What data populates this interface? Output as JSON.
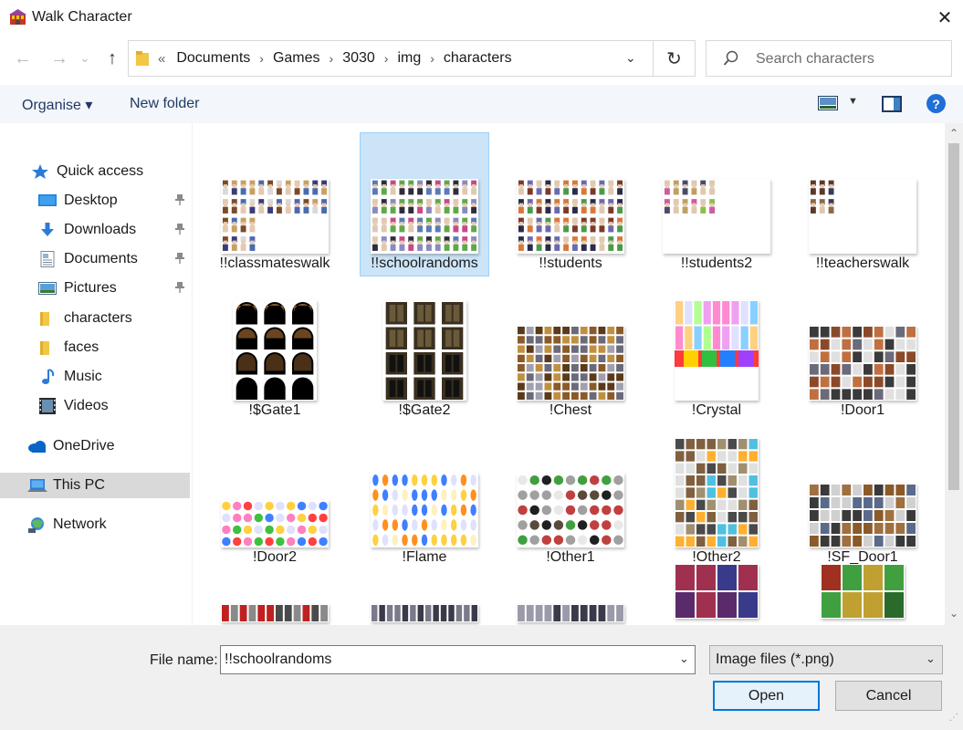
{
  "window": {
    "title": "Walk Character",
    "close_label": "✕"
  },
  "nav": {
    "back": "←",
    "forward": "→",
    "recent": "⌄",
    "up": "↑"
  },
  "address": {
    "lead": "«",
    "crumbs": [
      "Documents",
      "Games",
      "3030",
      "img",
      "characters"
    ],
    "refresh": "↻",
    "dropdown": "⌄"
  },
  "search": {
    "placeholder": "Search characters"
  },
  "toolbar": {
    "organise": "Organise ▾",
    "new_folder": "New folder",
    "view_dd": "▼",
    "help": "?"
  },
  "sidebar": {
    "items": [
      {
        "label": "Quick access",
        "icon": "star-icon",
        "pinned": false
      },
      {
        "label": "Desktop",
        "icon": "desktop-icon",
        "pinned": true
      },
      {
        "label": "Downloads",
        "icon": "download-icon",
        "pinned": true
      },
      {
        "label": "Documents",
        "icon": "document-icon",
        "pinned": true
      },
      {
        "label": "Pictures",
        "icon": "picture-icon",
        "pinned": true
      },
      {
        "label": "characters",
        "icon": "folder-icon",
        "pinned": false
      },
      {
        "label": "faces",
        "icon": "folder-icon",
        "pinned": false
      },
      {
        "label": "Music",
        "icon": "music-icon",
        "pinned": false
      },
      {
        "label": "Videos",
        "icon": "video-icon",
        "pinned": false
      },
      {
        "label": "OneDrive",
        "icon": "cloud-icon",
        "pinned": false
      },
      {
        "label": "This PC",
        "icon": "computer-icon",
        "pinned": false,
        "selected": true
      },
      {
        "label": "Network",
        "icon": "network-icon",
        "pinned": false
      }
    ],
    "pin_glyph": "📌"
  },
  "files": [
    {
      "name": "!!classmateswalk",
      "selected": false
    },
    {
      "name": "!!schoolrandoms",
      "selected": true
    },
    {
      "name": "!!students",
      "selected": false
    },
    {
      "name": "!!students2",
      "selected": false
    },
    {
      "name": "!!teacherswalk",
      "selected": false
    },
    {
      "name": "!$Gate1",
      "selected": false
    },
    {
      "name": "!$Gate2",
      "selected": false
    },
    {
      "name": "!Chest",
      "selected": false
    },
    {
      "name": "!Crystal",
      "selected": false
    },
    {
      "name": "!Door1",
      "selected": false
    },
    {
      "name": "!Door2",
      "selected": false
    },
    {
      "name": "!Flame",
      "selected": false
    },
    {
      "name": "!Other1",
      "selected": false
    },
    {
      "name": "!Other2",
      "selected": false
    },
    {
      "name": "!SF_Door1",
      "selected": false
    },
    {
      "name": "",
      "selected": false
    },
    {
      "name": "",
      "selected": false
    },
    {
      "name": "",
      "selected": false
    },
    {
      "name": "",
      "selected": false
    },
    {
      "name": "",
      "selected": false
    }
  ],
  "scroll": {
    "up": "⌃",
    "down": "⌄"
  },
  "footer": {
    "file_name_label": "File name:",
    "file_name_value": "!!schoolrandoms",
    "file_type": "Image files (*.png)",
    "dropdown": "⌄",
    "open": "Open",
    "cancel": "Cancel",
    "grip": "⋰"
  }
}
